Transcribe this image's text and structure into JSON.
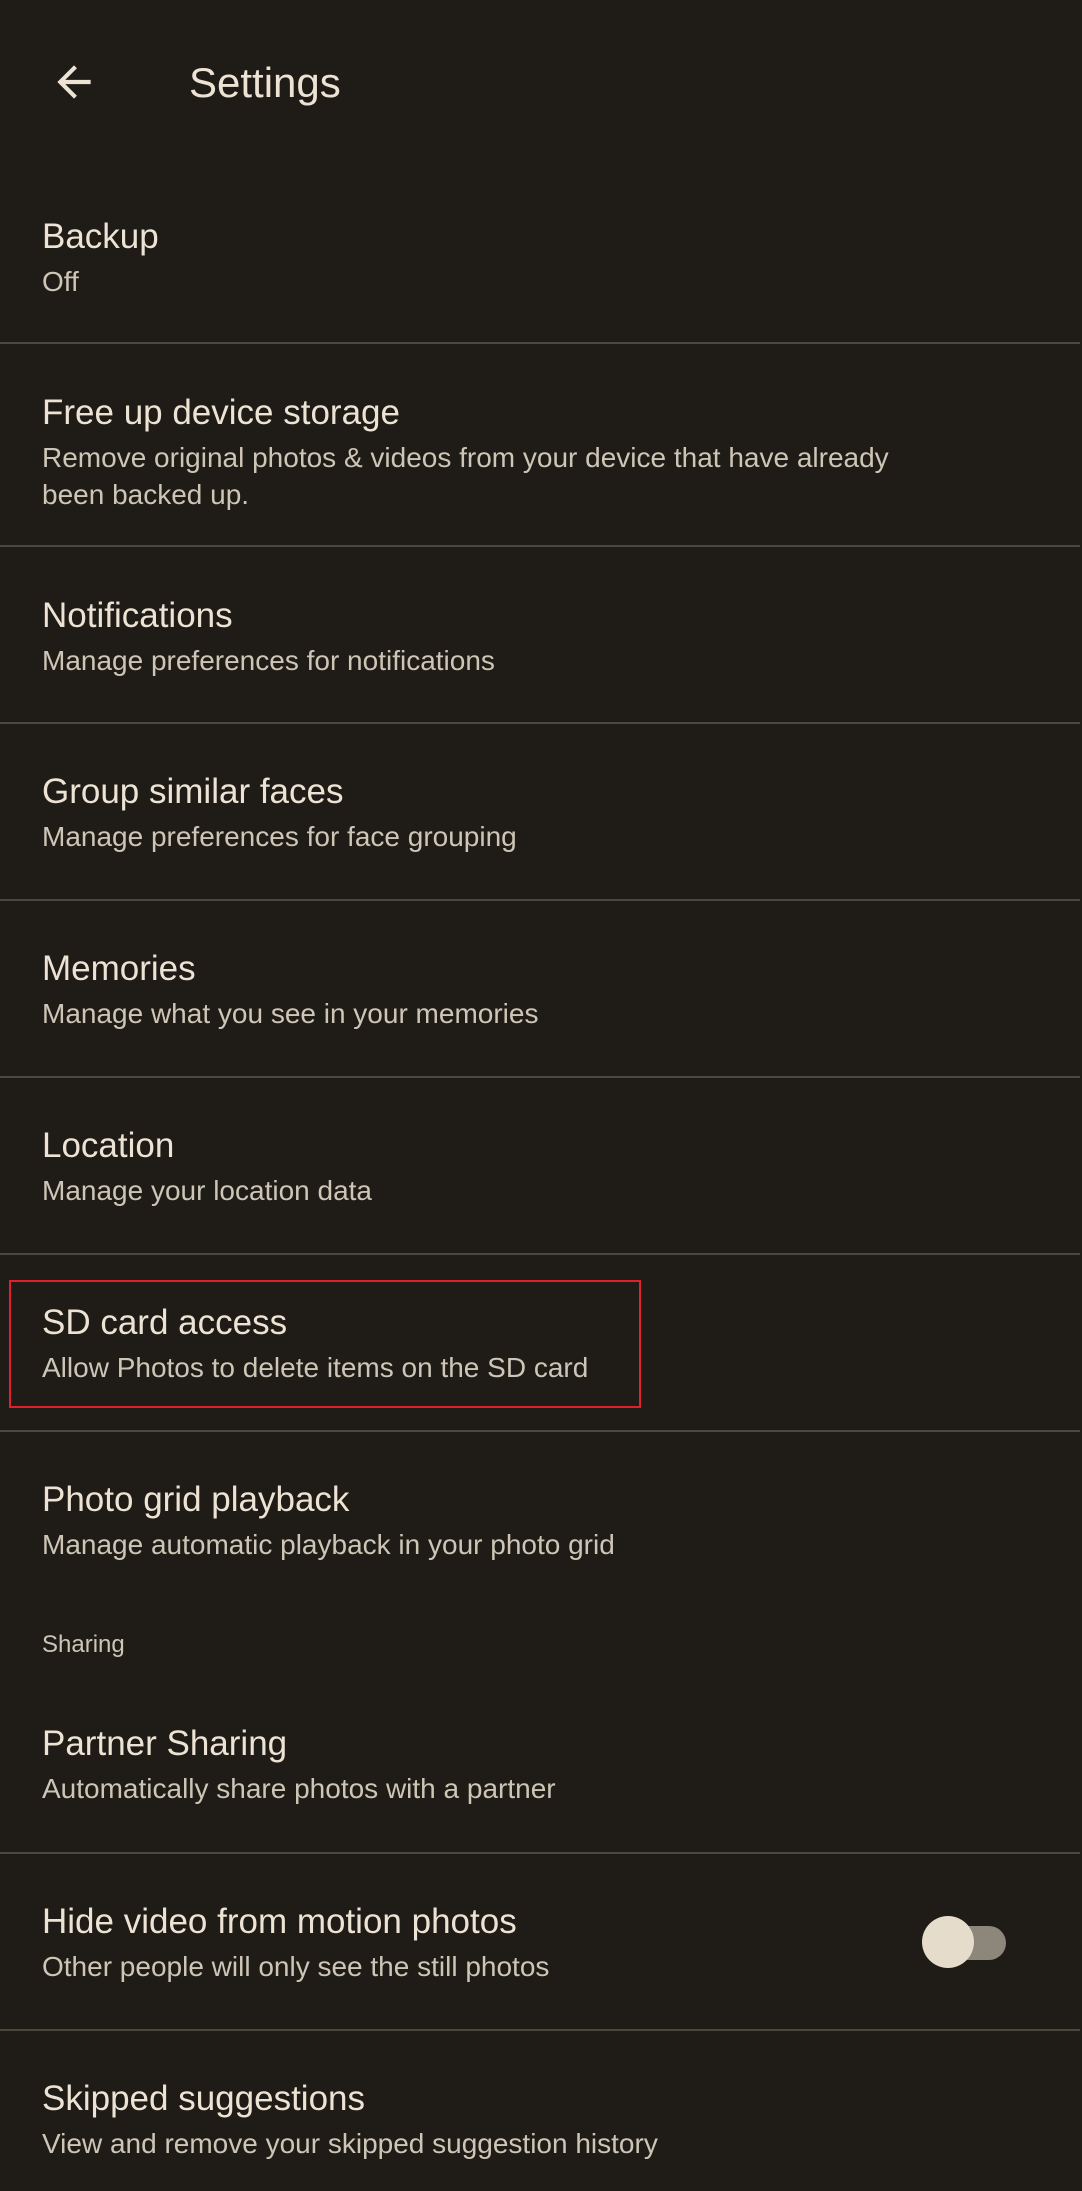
{
  "app_bar": {
    "title": "Settings",
    "back_icon": "arrow-back-icon"
  },
  "items": [
    {
      "title": "Backup",
      "subtitle": "Off"
    },
    {
      "title": "Free up device storage",
      "subtitle": "Remove original photos & videos from your device that have already been backed up."
    },
    {
      "title": "Notifications",
      "subtitle": "Manage preferences for notifications"
    },
    {
      "title": "Group similar faces",
      "subtitle": "Manage preferences for face grouping"
    },
    {
      "title": "Memories",
      "subtitle": "Manage what you see in your memories"
    },
    {
      "title": "Location",
      "subtitle": "Manage your location data"
    },
    {
      "title": "SD card access",
      "subtitle": "Allow Photos to delete items on the SD card"
    },
    {
      "title": "Photo grid playback",
      "subtitle": "Manage automatic playback in your photo grid"
    }
  ],
  "sharing": {
    "header": "Sharing",
    "items": [
      {
        "title": "Partner Sharing",
        "subtitle": "Automatically share photos with a partner"
      },
      {
        "title": "Hide video from motion photos",
        "subtitle": "Other people will only see the still photos",
        "toggle_on": false
      },
      {
        "title": "Skipped suggestions",
        "subtitle": "View and remove your skipped suggestion history"
      }
    ]
  },
  "colors": {
    "background": "#1f1b16",
    "text_primary": "#ece3d4",
    "text_secondary": "#cdc6b7",
    "divider": "#4c483e",
    "highlight": "#e0202c"
  }
}
